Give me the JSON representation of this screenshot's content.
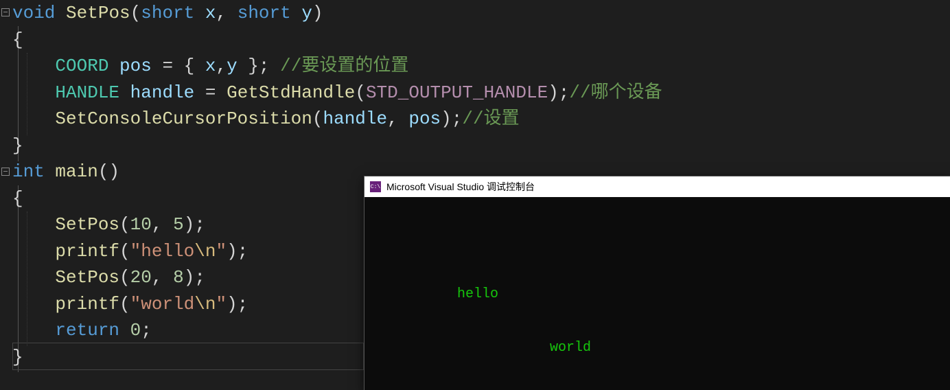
{
  "code": {
    "tokens": [
      [
        [
          "kw",
          "void"
        ],
        [
          "punc",
          " "
        ],
        [
          "fn",
          "SetPos"
        ],
        [
          "paren",
          "("
        ],
        [
          "type",
          "short"
        ],
        [
          "punc",
          " "
        ],
        [
          "var",
          "x"
        ],
        [
          "punc",
          ", "
        ],
        [
          "type",
          "short"
        ],
        [
          "punc",
          " "
        ],
        [
          "var",
          "y"
        ],
        [
          "paren",
          ")"
        ]
      ],
      [
        [
          "punc",
          "{"
        ]
      ],
      [
        [
          "punc",
          "    "
        ],
        [
          "upper",
          "COORD"
        ],
        [
          "punc",
          " "
        ],
        [
          "var",
          "pos"
        ],
        [
          "punc",
          " = { "
        ],
        [
          "var",
          "x"
        ],
        [
          "punc",
          ","
        ],
        [
          "var",
          "y"
        ],
        [
          "punc",
          " }; "
        ],
        [
          "cmt",
          "//要设置的位置"
        ]
      ],
      [
        [
          "punc",
          "    "
        ],
        [
          "upper",
          "HANDLE"
        ],
        [
          "punc",
          " "
        ],
        [
          "var",
          "handle"
        ],
        [
          "punc",
          " = "
        ],
        [
          "fn",
          "GetStdHandle"
        ],
        [
          "paren",
          "("
        ],
        [
          "macro",
          "STD_OUTPUT_HANDLE"
        ],
        [
          "paren",
          ")"
        ],
        [
          "punc",
          ";"
        ],
        [
          "cmt",
          "//哪个设备"
        ]
      ],
      [
        [
          "punc",
          "    "
        ],
        [
          "fn",
          "SetConsoleCursorPosition"
        ],
        [
          "paren",
          "("
        ],
        [
          "var",
          "handle"
        ],
        [
          "punc",
          ", "
        ],
        [
          "var",
          "pos"
        ],
        [
          "paren",
          ")"
        ],
        [
          "punc",
          ";"
        ],
        [
          "cmt",
          "//设置"
        ]
      ],
      [
        [
          "punc",
          "}"
        ]
      ],
      [
        [
          "type",
          "int"
        ],
        [
          "punc",
          " "
        ],
        [
          "fn",
          "main"
        ],
        [
          "paren",
          "()"
        ]
      ],
      [
        [
          "punc",
          "{"
        ]
      ],
      [
        [
          "punc",
          "    "
        ],
        [
          "fn",
          "SetPos"
        ],
        [
          "paren",
          "("
        ],
        [
          "num",
          "10"
        ],
        [
          "punc",
          ", "
        ],
        [
          "num",
          "5"
        ],
        [
          "paren",
          ")"
        ],
        [
          "punc",
          ";"
        ]
      ],
      [
        [
          "punc",
          "    "
        ],
        [
          "fn",
          "printf"
        ],
        [
          "paren",
          "("
        ],
        [
          "str",
          "\"hello"
        ],
        [
          "esc",
          "\\n"
        ],
        [
          "str",
          "\""
        ],
        [
          "paren",
          ")"
        ],
        [
          "punc",
          ";"
        ]
      ],
      [
        [
          "punc",
          "    "
        ],
        [
          "fn",
          "SetPos"
        ],
        [
          "paren",
          "("
        ],
        [
          "num",
          "20"
        ],
        [
          "punc",
          ", "
        ],
        [
          "num",
          "8"
        ],
        [
          "paren",
          ")"
        ],
        [
          "punc",
          ";"
        ]
      ],
      [
        [
          "punc",
          "    "
        ],
        [
          "fn",
          "printf"
        ],
        [
          "paren",
          "("
        ],
        [
          "str",
          "\"world"
        ],
        [
          "esc",
          "\\n"
        ],
        [
          "str",
          "\""
        ],
        [
          "paren",
          ")"
        ],
        [
          "punc",
          ";"
        ]
      ],
      [
        [
          "punc",
          "    "
        ],
        [
          "kw",
          "return"
        ],
        [
          "punc",
          " "
        ],
        [
          "num",
          "0"
        ],
        [
          "punc",
          ";"
        ]
      ],
      [
        [
          "punc",
          "}"
        ]
      ]
    ]
  },
  "console": {
    "title": "Microsoft Visual Studio 调试控制台",
    "icon_label": "C:\\",
    "output": [
      {
        "text": "hello",
        "col": 10,
        "row": 5
      },
      {
        "text": "world",
        "col": 20,
        "row": 8
      }
    ]
  }
}
